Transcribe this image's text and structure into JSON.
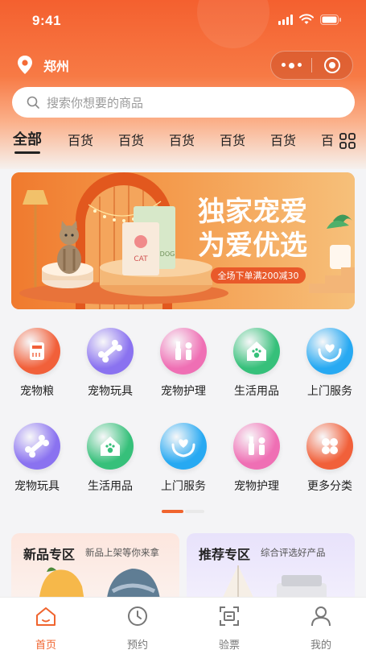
{
  "status_bar": {
    "time": "9:41"
  },
  "location": {
    "city": "郑州"
  },
  "search": {
    "placeholder": "搜索你想要的商品"
  },
  "categories": [
    "全部",
    "百货",
    "百货",
    "百货",
    "百货",
    "百货",
    "百"
  ],
  "banner": {
    "headline_1": "独家宠爱",
    "headline_2": "为爱优选",
    "promo": "全场下单满200减30",
    "box_label_1": "CAT",
    "box_label_2": "DOG"
  },
  "service_icons": [
    {
      "label": "宠物粮",
      "icon": "pet-food-icon",
      "color": "#f1603a"
    },
    {
      "label": "宠物玩具",
      "icon": "bone-toy-icon",
      "color": "#8a72f0"
    },
    {
      "label": "宠物护理",
      "icon": "grooming-icon",
      "color": "#ef6fb4"
    },
    {
      "label": "生活用品",
      "icon": "pet-house-icon",
      "color": "#36c07a"
    },
    {
      "label": "上门服务",
      "icon": "care-hands-icon",
      "color": "#27a9f2"
    },
    {
      "label": "宠物玩具",
      "icon": "bone-toy-icon",
      "color": "#8a72f0"
    },
    {
      "label": "生活用品",
      "icon": "pet-house-icon",
      "color": "#36c07a"
    },
    {
      "label": "上门服务",
      "icon": "care-hands-icon",
      "color": "#27a9f2"
    },
    {
      "label": "宠物护理",
      "icon": "grooming-icon",
      "color": "#ef6fb4"
    },
    {
      "label": "更多分类",
      "icon": "more-categories-icon",
      "color": "#f1603a"
    }
  ],
  "sections": [
    {
      "title": "新品专区",
      "subtitle": "新品上架等你来拿"
    },
    {
      "title": "推荐专区",
      "subtitle": "综合评选好产品"
    }
  ],
  "tabbar": [
    {
      "label": "首页",
      "icon": "home-icon",
      "active": true
    },
    {
      "label": "预约",
      "icon": "clock-icon",
      "active": false
    },
    {
      "label": "验票",
      "icon": "scan-ticket-icon",
      "active": false
    },
    {
      "label": "我的",
      "icon": "profile-icon",
      "active": false
    }
  ],
  "colors": {
    "accent": "#f0642e",
    "header_top": "#f4602f"
  }
}
